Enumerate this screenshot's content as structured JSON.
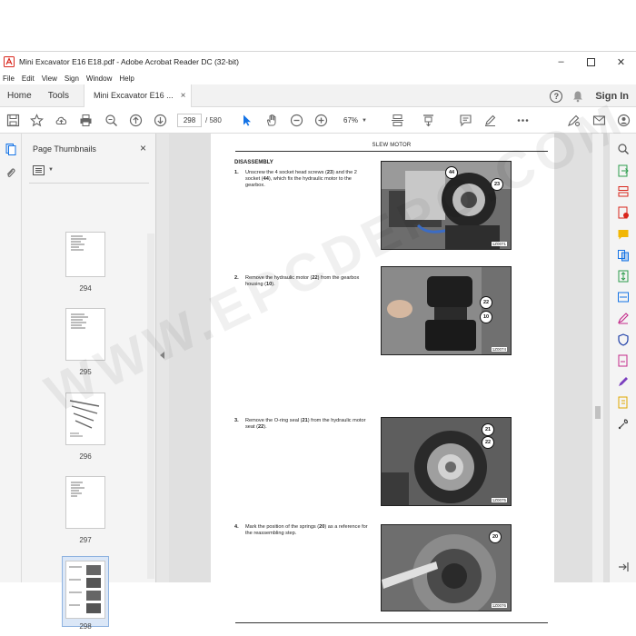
{
  "window": {
    "title": "Mini Excavator E16 E18.pdf - Adobe Acrobat Reader DC (32-bit)",
    "controls": [
      "minimize",
      "maximize",
      "close"
    ]
  },
  "menu": [
    "File",
    "Edit",
    "View",
    "Sign",
    "Window",
    "Help"
  ],
  "tabs": {
    "home": "Home",
    "tools": "Tools",
    "document": "Mini Excavator E16 ...",
    "close": "×",
    "sign_in": "Sign In"
  },
  "toolbar": {
    "current_page": "298",
    "total_pages": "/ 580",
    "zoom": "67%"
  },
  "thumbnails": {
    "title": "Page Thumbnails",
    "close": "×",
    "pages": [
      "294",
      "295",
      "296",
      "297",
      "298"
    ],
    "selected": "298"
  },
  "document": {
    "header": "SLEW MOTOR",
    "section": "DISASSEMBLY",
    "steps": [
      {
        "num": "1.",
        "html": "Unscrew the 4 socket head screws (<b>23</b>) and the 2 socket (<b>44</b>), which fix the hydraulic motor to the gearbox.",
        "photo_code": "1Z0071",
        "callouts": [
          "44",
          "23"
        ]
      },
      {
        "num": "2.",
        "html": "Remove the hydraulic motor (<b>22</b>) from the gearbox housing (<b>10</b>).",
        "photo_code": "1Z0074",
        "callouts": [
          "22",
          "10"
        ]
      },
      {
        "num": "3.",
        "html": "Remove the O-ring seal (<b>21</b>) from the hydraulic motor seat (<b>22</b>).",
        "photo_code": "1Z0075",
        "callouts": [
          "21",
          "22"
        ]
      },
      {
        "num": "4.",
        "html": "Mark the position of the springs (<b>20</b>) as a reference for the reassembling step.",
        "photo_code": "1Z0076",
        "callouts": [
          "20"
        ]
      }
    ]
  },
  "watermark": "WWW.EPCDEPO.COM",
  "colors": {
    "accent": "#1473e6",
    "logo_red": "#d9261c",
    "rail_purple": "#7b3fbf",
    "rail_green": "#2d9d4d"
  }
}
